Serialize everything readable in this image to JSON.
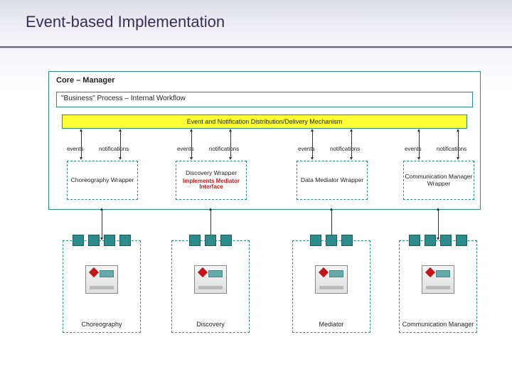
{
  "title": "Event-based Implementation",
  "core": {
    "title": "Core – Manager",
    "bp": "\"Business\" Process – Internal Workflow",
    "mechanism": "Event and Notification Distribution/Delivery Mechanism"
  },
  "labels": {
    "events": "events",
    "notifications": "notifications"
  },
  "wrappers": [
    {
      "name": "Choreography Wrapper"
    },
    {
      "name": "Discovery Wrapper",
      "implements": "Implements Mediator Interface"
    },
    {
      "name": "Data Mediator Wrapper"
    },
    {
      "name": "Communication Manager Wrapper"
    }
  ],
  "externals": [
    {
      "name": "Choreography"
    },
    {
      "name": "Discovery"
    },
    {
      "name": "Mediator"
    },
    {
      "name": "Communication Manager"
    }
  ]
}
